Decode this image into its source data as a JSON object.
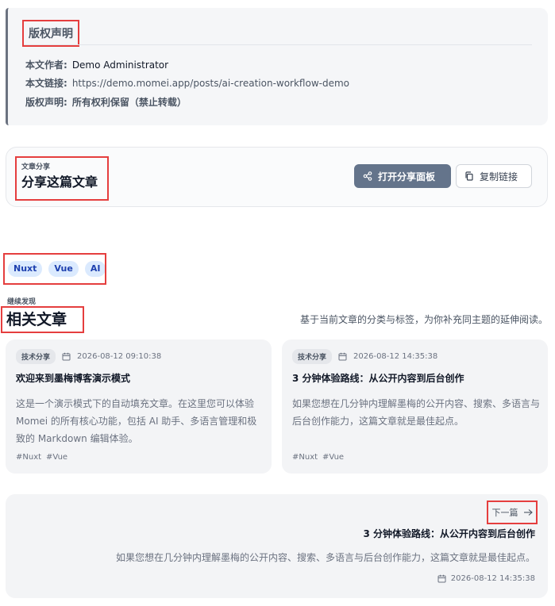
{
  "copyright": {
    "title": "版权声明",
    "author_label": "本文作者:",
    "author": "Demo Administrator",
    "link_label": "本文链接:",
    "link": "https://demo.momei.app/posts/ai-creation-workflow-demo",
    "license_label": "版权声明:",
    "license": "所有权利保留（禁止转载）"
  },
  "share": {
    "eyebrow": "文章分享",
    "title": "分享这篇文章",
    "open_panel": "打开分享面板",
    "copy_link": "复制链接"
  },
  "tags": [
    "Nuxt",
    "Vue",
    "AI"
  ],
  "related": {
    "eyebrow": "继续发现",
    "title": "相关文章",
    "description": "基于当前文章的分类与标签，为你补充同主题的延伸阅读。",
    "cards": [
      {
        "category": "技术分享",
        "date": "2026-08-12 09:10:38",
        "title": "欢迎来到墨梅博客演示模式",
        "excerpt": "这是一个演示模式下的自动填充文章。在这里您可以体验 Momei 的所有核心功能，包括 AI 助手、多语言管理和极致的 Markdown 编辑体验。",
        "tags": [
          "#Nuxt",
          "#Vue"
        ]
      },
      {
        "category": "技术分享",
        "date": "2026-08-12 14:35:38",
        "title": "3 分钟体验路线：从公开内容到后台创作",
        "excerpt": "如果您想在几分钟内理解墨梅的公开内容、搜索、多语言与后台创作能力，这篇文章就是最佳起点。",
        "tags": [
          "#Nuxt",
          "#Vue"
        ]
      }
    ]
  },
  "next_post": {
    "label": "下一篇",
    "title": "3 分钟体验路线：从公开内容到后台创作",
    "excerpt": "如果您想在几分钟内理解墨梅的公开内容、搜索、多语言与后台创作能力，这篇文章就是最佳起点。",
    "date": "2026-08-12 14:35:38"
  },
  "colors": {
    "highlight": "#e53e3e",
    "primary_button": "#64748b",
    "tag_bg": "#dbeafe",
    "tag_text": "#1e40af"
  },
  "icons": {
    "share": "share-icon",
    "copy": "copy-icon",
    "calendar": "calendar-icon",
    "next": "arrow-right-icon"
  }
}
